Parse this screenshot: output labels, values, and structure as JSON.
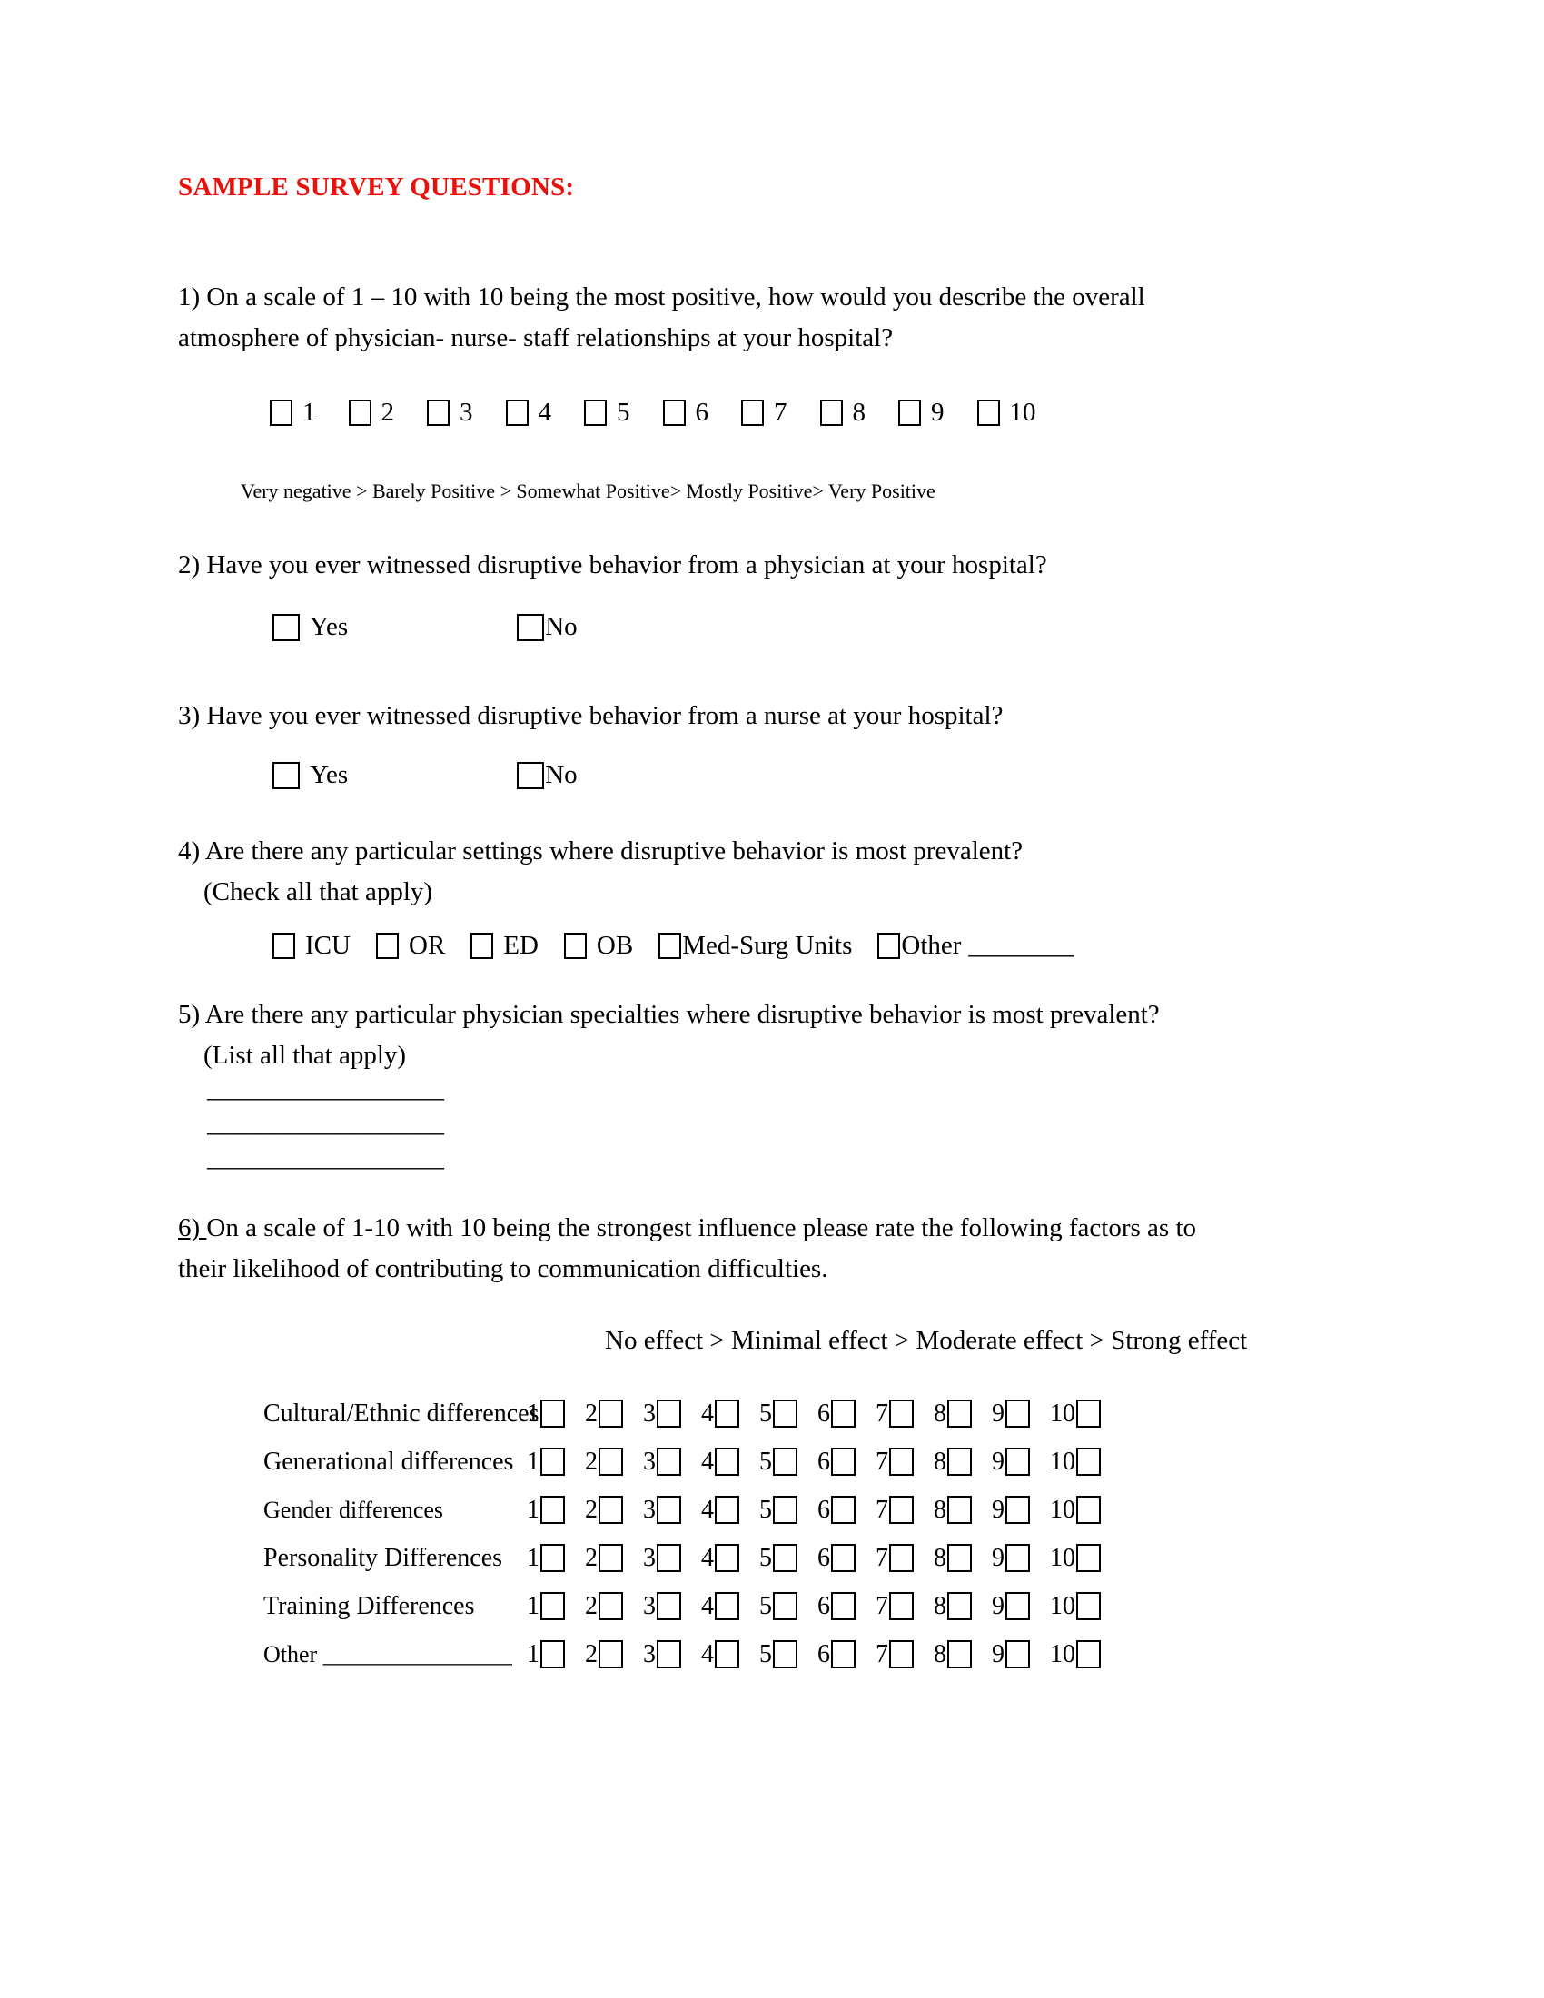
{
  "document": {
    "title": "SAMPLE SURVEY QUESTIONS:",
    "title_color": "#e8120b"
  },
  "questions": [
    {
      "number": "1)",
      "text_line1": "1) On a scale of 1 – 10 with 10 being the most positive, how would you describe the overall",
      "text_line2": "atmosphere of physician- nurse- staff relationships at your hospital?",
      "options": [
        "1",
        "2",
        "3",
        "4",
        "5",
        "6",
        "7",
        "8",
        "9",
        "10"
      ],
      "scale_caption": "Very negative >  Barely Positive >  Somewhat Positive>  Mostly Positive>  Very Positive"
    },
    {
      "number": "2)",
      "text_line1": "2) Have you ever witnessed disruptive behavior from a physician at your hospital?",
      "options": [
        "Yes",
        "No"
      ]
    },
    {
      "number": "3)",
      "text_line1": "3) Have you ever witnessed disruptive behavior from a nurse at your hospital?",
      "options": [
        "Yes",
        "No"
      ]
    },
    {
      "number": "4)",
      "text_line1": "4) Are there any particular settings where disruptive behavior is most prevalent?",
      "text_line2": "(Check all that apply)",
      "options": [
        "ICU",
        "OR",
        "ED",
        "OB",
        "Med-Surg Units",
        "Other"
      ],
      "other_blank": "________"
    },
    {
      "number": "5)",
      "text_line1": "5) Are there any particular physician specialties where disruptive behavior is most prevalent?",
      "text_line2": "(List all that apply)",
      "blank_lines": [
        "__________________",
        "__________________",
        "__________________"
      ]
    },
    {
      "number": "6)",
      "number_underlined": "6) ",
      "text_line1_rest": "On a scale of 1-10 with 10 being the strongest influence please rate the following factors as to",
      "text_line2": "their likelihood of contributing to communication difficulties.",
      "effect_header": "No effect > Minimal effect > Moderate effect > Strong effect",
      "matrix": {
        "columns": [
          "1",
          "2",
          "3",
          "4",
          "5",
          "6",
          "7",
          "8",
          "9",
          "10"
        ],
        "rows": [
          {
            "label": "Cultural/Ethnic differences"
          },
          {
            "label": "Generational differences"
          },
          {
            "label": "Gender differences"
          },
          {
            "label": "Personality Differences"
          },
          {
            "label": "Training Differences"
          },
          {
            "label": "Other ________________"
          }
        ]
      }
    }
  ]
}
